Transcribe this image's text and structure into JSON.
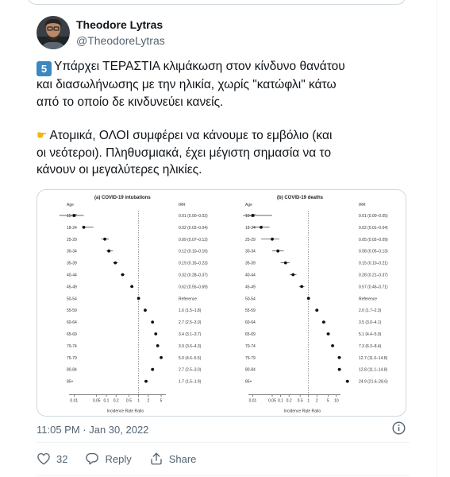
{
  "tweet": {
    "display_name": "Theodore Lytras",
    "handle": "@TheodoreLytras",
    "keycap": "5",
    "line1": "Υπάρχει ΤΕΡΑΣΤΙΑ κλιμάκωση στον κίνδυνο θανάτου",
    "line2": "και διασωλήνωσης με την ηλικία, χωρίς \"κατώφλι\" κάτω",
    "line3": "από το οποίο δε κινδυνεύει κανείς.",
    "line4": "Ατομικά, ΟΛΟΙ συμφέρει να κάνουμε το εμβόλιο (και",
    "line5": "οι νεότεροι). Πληθυσμιακά, έχει μέγιστη σημασία να το",
    "line6": "κάνουν οι μεγαλύτερες ηλικίες.",
    "timestamp": "11:05 PM · Jan 30, 2022"
  },
  "actions": {
    "likes": "32",
    "reply_label": "Reply",
    "share_label": "Share"
  },
  "icons": [
    "pointing-hand-icon",
    "info-icon",
    "heart-icon",
    "reply-icon",
    "share-icon"
  ],
  "colors": {
    "keycap_bg": "#3b88c3",
    "muted": "#536471",
    "border": "#cfd9de"
  },
  "chart_data": [
    {
      "type": "scatter",
      "title": "(a) COVID-19 intubations",
      "ylabel": "Age",
      "xlabel": "Incidence Rate Ratio",
      "column_header": "IRR",
      "x_scale": "log",
      "xlim": [
        0.007,
        7
      ],
      "x_ticks": [
        "0.01",
        "0.05",
        "0.1",
        "0.2",
        "0.5",
        "1",
        "2",
        "5"
      ],
      "reference_line": 1,
      "categories": [
        "15-17",
        "18-24",
        "25-29",
        "30-34",
        "35-39",
        "40-44",
        "45-49",
        "50-54",
        "55-59",
        "60-64",
        "65-69",
        "70-74",
        "75-79",
        "80-84",
        "85+"
      ],
      "rows": [
        {
          "age": "15-17",
          "est": 0.01,
          "lo": 0.0035,
          "hi": 0.02,
          "label": "0.01 (0.00–0.02)"
        },
        {
          "age": "18-24",
          "est": 0.02,
          "lo": 0.02,
          "hi": 0.04,
          "label": "0.02 (0.02–0.04)"
        },
        {
          "age": "25-29",
          "est": 0.09,
          "lo": 0.07,
          "hi": 0.12,
          "label": "0.09 (0.07–0.12)"
        },
        {
          "age": "30-34",
          "est": 0.12,
          "lo": 0.1,
          "hi": 0.16,
          "label": "0.12 (0.10–0.16)"
        },
        {
          "age": "35-39",
          "est": 0.19,
          "lo": 0.16,
          "hi": 0.23,
          "label": "0.19 (0.16–0.23)"
        },
        {
          "age": "40-44",
          "est": 0.32,
          "lo": 0.28,
          "hi": 0.37,
          "label": "0.32 (0.28–0.37)"
        },
        {
          "age": "45-49",
          "est": 0.62,
          "lo": 0.55,
          "hi": 0.69,
          "label": "0.62 (0.55–0.69)"
        },
        {
          "age": "50-54",
          "est": 1,
          "lo": 1,
          "hi": 1,
          "label": "Reference"
        },
        {
          "age": "55-59",
          "est": 1.6,
          "lo": 1.5,
          "hi": 1.8,
          "label": "1.6 (1.5–1.8)"
        },
        {
          "age": "60-64",
          "est": 2.7,
          "lo": 2.5,
          "hi": 3.0,
          "label": "2.7 (2.5–3.0)"
        },
        {
          "age": "65-69",
          "est": 3.4,
          "lo": 3.1,
          "hi": 3.7,
          "label": "3.4 (3.1–3.7)"
        },
        {
          "age": "70-74",
          "est": 3.9,
          "lo": 3.6,
          "hi": 4.3,
          "label": "3.9 (3.6–4.3)"
        },
        {
          "age": "75-79",
          "est": 5.0,
          "lo": 4.6,
          "hi": 5.5,
          "label": "5.0 (4.6–5.5)"
        },
        {
          "age": "80-84",
          "est": 2.7,
          "lo": 2.5,
          "hi": 3.0,
          "label": "2.7 (2.5–3.0)"
        },
        {
          "age": "85+",
          "est": 1.7,
          "lo": 1.5,
          "hi": 1.9,
          "label": "1.7 (1.5–1.9)"
        }
      ]
    },
    {
      "type": "scatter",
      "title": "(b) COVID-19 deaths",
      "ylabel": "Age",
      "xlabel": "Incidence Rate Ratio",
      "column_header": "IRR",
      "x_scale": "log",
      "xlim": [
        0.007,
        14
      ],
      "x_ticks": [
        "0.01",
        "0.05",
        "0.1",
        "0.2",
        "0.5",
        "1",
        "2",
        "5",
        "10"
      ],
      "reference_line": 1,
      "categories": [
        "15-17",
        "18-24",
        "25-29",
        "30-34",
        "35-39",
        "40-44",
        "45-49",
        "50-54",
        "55-59",
        "60-64",
        "65-69",
        "70-74",
        "75-79",
        "80-84",
        "85+"
      ],
      "rows": [
        {
          "age": "15-17",
          "est": 0.01,
          "lo": 0.0045,
          "hi": 0.05,
          "label": "0.01 (0.00–0.05)"
        },
        {
          "age": "18-24",
          "est": 0.02,
          "lo": 0.01,
          "hi": 0.04,
          "label": "0.02 (0.01–0.04)"
        },
        {
          "age": "25-29",
          "est": 0.05,
          "lo": 0.02,
          "hi": 0.09,
          "label": "0.05 (0.02–0.09)"
        },
        {
          "age": "30-34",
          "est": 0.08,
          "lo": 0.05,
          "hi": 0.13,
          "label": "0.08 (0.05–0.13)"
        },
        {
          "age": "35-39",
          "est": 0.15,
          "lo": 0.1,
          "hi": 0.21,
          "label": "0.15 (0.10–0.21)"
        },
        {
          "age": "40-44",
          "est": 0.28,
          "lo": 0.21,
          "hi": 0.37,
          "label": "0.28 (0.21–0.37)"
        },
        {
          "age": "45-49",
          "est": 0.57,
          "lo": 0.46,
          "hi": 0.71,
          "label": "0.57 (0.46–0.71)"
        },
        {
          "age": "50-54",
          "est": 1,
          "lo": 1,
          "hi": 1,
          "label": "Reference"
        },
        {
          "age": "55-59",
          "est": 2.0,
          "lo": 1.7,
          "hi": 2.3,
          "label": "2.0 (1.7–2.3)"
        },
        {
          "age": "60-64",
          "est": 3.5,
          "lo": 3.0,
          "hi": 4.1,
          "label": "3.5 (3.0–4.1)"
        },
        {
          "age": "65-69",
          "est": 5.1,
          "lo": 4.4,
          "hi": 5.9,
          "label": "5.1 (4.4–5.9)"
        },
        {
          "age": "70-74",
          "est": 7.3,
          "lo": 6.3,
          "hi": 8.4,
          "label": "7.3 (6.3–8.4)"
        },
        {
          "age": "75-79",
          "est": 12.7,
          "lo": 11.0,
          "hi": 14.8,
          "label": "12.7 (11.0–14.8)"
        },
        {
          "age": "80-84",
          "est": 12.8,
          "lo": 11.1,
          "hi": 14.8,
          "label": "12.8 (11.1–14.8)"
        },
        {
          "age": "85+",
          "est": 24.9,
          "lo": 21.6,
          "hi": 28.6,
          "label": "24.9 (21.6–28.6)"
        }
      ]
    }
  ]
}
